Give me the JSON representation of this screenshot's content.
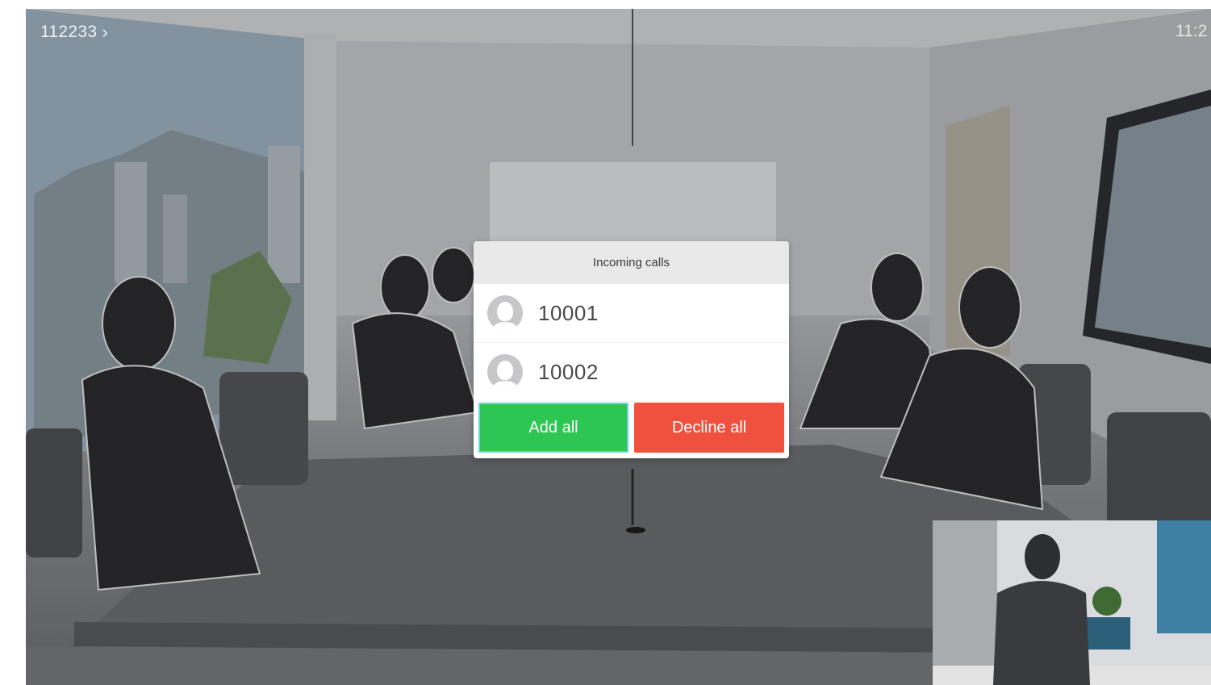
{
  "header": {
    "call_id": "112233",
    "chevron": "›",
    "clock": "11:2"
  },
  "dialog": {
    "title": "Incoming calls",
    "calls": [
      {
        "number": "10001",
        "icon": "avatar-icon"
      },
      {
        "number": "10002",
        "icon": "avatar-icon"
      }
    ],
    "buttons": {
      "add_all": "Add all",
      "decline_all": "Decline all"
    }
  },
  "colors": {
    "add": "#2dc653",
    "decline": "#f0503e",
    "focus_ring": "#6fd1e8"
  }
}
